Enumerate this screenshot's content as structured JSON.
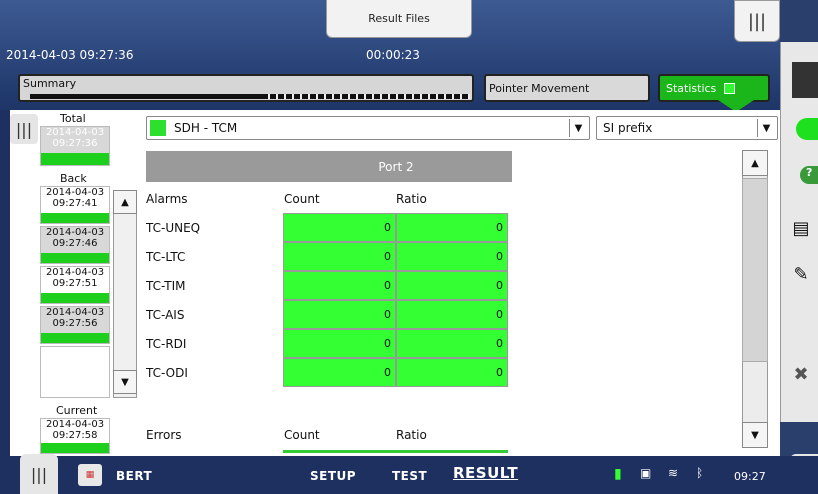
{
  "header": {
    "result_files": "Result Files",
    "datetime": "2014-04-03 09:27:36",
    "elapsed": "00:00:23",
    "tabs": {
      "summary": "Summary",
      "pointer": "Pointer Movement",
      "statistics": "Statistics"
    }
  },
  "left": {
    "total": {
      "label": "Total",
      "date": "2014-04-03",
      "time": "09:27:36"
    },
    "back": {
      "label": "Back"
    },
    "snapshots": [
      {
        "date": "2014-04-03",
        "time": "09:27:41"
      },
      {
        "date": "2014-04-03",
        "time": "09:27:46"
      },
      {
        "date": "2014-04-03",
        "time": "09:27:51"
      },
      {
        "date": "2014-04-03",
        "time": "09:27:56"
      }
    ],
    "current": {
      "label": "Current",
      "date": "2014-04-03",
      "time": "09:27:58"
    }
  },
  "filters": {
    "signal": "SDH - TCM",
    "prefix": "SI prefix"
  },
  "table": {
    "port": "Port 2",
    "alarms": {
      "heading": "Alarms",
      "col_count": "Count",
      "col_ratio": "Ratio",
      "rows": [
        {
          "name": "TC-UNEQ",
          "count": "0",
          "ratio": "0"
        },
        {
          "name": "TC-LTC",
          "count": "0",
          "ratio": "0"
        },
        {
          "name": "TC-TIM",
          "count": "0",
          "ratio": "0"
        },
        {
          "name": "TC-AIS",
          "count": "0",
          "ratio": "0"
        },
        {
          "name": "TC-RDI",
          "count": "0",
          "ratio": "0"
        },
        {
          "name": "TC-ODI",
          "count": "0",
          "ratio": "0"
        }
      ]
    },
    "errors": {
      "heading": "Errors",
      "col_count": "Count",
      "col_ratio": "Ratio"
    }
  },
  "bottom": {
    "app": "BERT",
    "setup": "SETUP",
    "test": "TEST",
    "result": "RESULT",
    "clock": "09:27"
  },
  "colors": {
    "ok_green": "#33ff33",
    "accent": "#1ab61a"
  }
}
